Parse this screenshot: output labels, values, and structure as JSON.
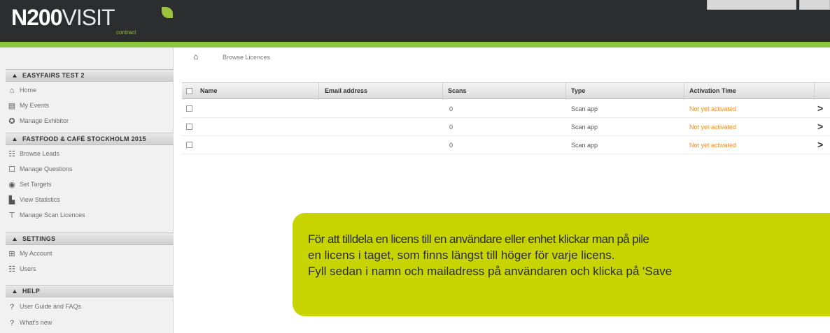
{
  "header": {
    "logo_bold": "N200",
    "logo_light": "VISIT",
    "logo_sub": "contract"
  },
  "sidebar": {
    "sections": [
      {
        "title": "EASYFAIRS TEST 2",
        "items": [
          {
            "label": "Home",
            "icon": "home-icon"
          },
          {
            "label": "My Events",
            "icon": "calendar-icon"
          },
          {
            "label": "Manage Exhibitor",
            "icon": "gear-icon"
          }
        ]
      },
      {
        "title": "FASTFOOD & CAFÉ STOCKHOLM 2015",
        "items": [
          {
            "label": "Browse Leads",
            "icon": "people-icon"
          },
          {
            "label": "Manage Questions",
            "icon": "document-icon"
          },
          {
            "label": "Set Targets",
            "icon": "target-icon"
          },
          {
            "label": "View Statistics",
            "icon": "chart-icon"
          },
          {
            "label": "Manage Scan Licences",
            "icon": "scanner-icon"
          }
        ]
      },
      {
        "title": "SETTINGS",
        "items": [
          {
            "label": "My Account",
            "icon": "account-icon"
          },
          {
            "label": "Users",
            "icon": "users-icon"
          }
        ]
      },
      {
        "title": "HELP",
        "items": [
          {
            "label": "User Guide and FAQs",
            "icon": "question-icon"
          },
          {
            "label": "What's new",
            "icon": "question-icon"
          }
        ]
      }
    ]
  },
  "breadcrumb": {
    "current": "Browse Licences"
  },
  "table": {
    "columns": [
      "Name",
      "Email address",
      "Scans",
      "Type",
      "Activation Time"
    ],
    "rows": [
      {
        "name": "",
        "email": "",
        "scans": "0",
        "type": "Scan app",
        "activation": "Not yet activated"
      },
      {
        "name": "",
        "email": "",
        "scans": "0",
        "type": "Scan app",
        "activation": "Not yet activated"
      },
      {
        "name": "",
        "email": "",
        "scans": "0",
        "type": "Scan app",
        "activation": "Not yet activated"
      }
    ],
    "row_arrow": ">"
  },
  "callout": {
    "line1": "För att tilldela en licens till en användare eller enhet klickar man på pile",
    "line2": "en licens i taget, som finns längst till höger för varje licens.",
    "line3": "Fyll sedan i namn och mailadress på användaren och klicka på 'Save"
  },
  "colors": {
    "header_bg": "#2b2d2f",
    "accent_green": "#8cc63f",
    "callout_bg": "#c8d400",
    "status_orange": "#f08a24"
  }
}
